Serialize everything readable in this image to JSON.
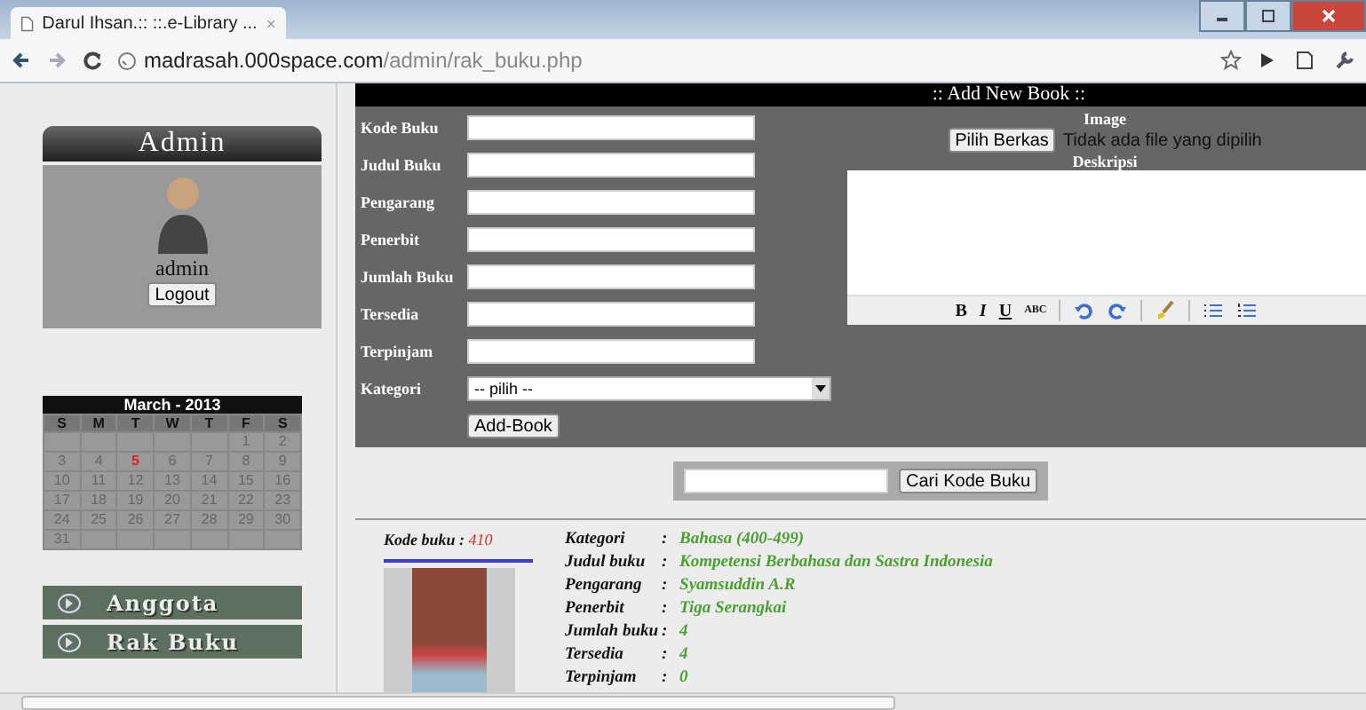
{
  "browser": {
    "tab_title": "Darul Ihsan.:: ::.e-Library ...",
    "url_host": "madrasah.000space.com",
    "url_path": "/admin/rak_buku.php"
  },
  "sidebar": {
    "admin_title": "Admin",
    "username": "admin",
    "logout_label": "Logout",
    "calendar": {
      "title": "March - 2013",
      "weekdays": [
        "S",
        "M",
        "T",
        "W",
        "T",
        "F",
        "S"
      ],
      "weeks": [
        [
          {
            "kind": "blank"
          },
          {
            "kind": "blank"
          },
          {
            "kind": "blank"
          },
          {
            "kind": "blank"
          },
          {
            "kind": "blank"
          },
          {
            "day": "1",
            "today": false
          },
          {
            "day": "2",
            "today": false
          }
        ],
        [
          {
            "day": "3",
            "today": false
          },
          {
            "day": "4",
            "today": false
          },
          {
            "day": "5",
            "today": true
          },
          {
            "day": "6",
            "today": false
          },
          {
            "day": "7",
            "today": false
          },
          {
            "day": "8",
            "today": false
          },
          {
            "day": "9",
            "today": false
          }
        ],
        [
          {
            "day": "10",
            "today": false
          },
          {
            "day": "11",
            "today": false
          },
          {
            "day": "12",
            "today": false
          },
          {
            "day": "13",
            "today": false
          },
          {
            "day": "14",
            "today": false
          },
          {
            "day": "15",
            "today": false
          },
          {
            "day": "16",
            "today": false
          }
        ],
        [
          {
            "day": "17",
            "today": false
          },
          {
            "day": "18",
            "today": false
          },
          {
            "day": "19",
            "today": false
          },
          {
            "day": "20",
            "today": false
          },
          {
            "day": "21",
            "today": false
          },
          {
            "day": "22",
            "today": false
          },
          {
            "day": "23",
            "today": false
          }
        ],
        [
          {
            "day": "24",
            "today": false
          },
          {
            "day": "25",
            "today": false
          },
          {
            "day": "26",
            "today": false
          },
          {
            "day": "27",
            "today": false
          },
          {
            "day": "28",
            "today": false
          },
          {
            "day": "29",
            "today": false
          },
          {
            "day": "30",
            "today": false
          }
        ],
        [
          {
            "day": "31",
            "today": false
          },
          {
            "kind": "blank"
          },
          {
            "kind": "blank"
          },
          {
            "kind": "blank"
          },
          {
            "kind": "blank"
          },
          {
            "kind": "blank"
          },
          {
            "kind": "blank"
          }
        ]
      ]
    },
    "menu": [
      "Anggota",
      "Rak Buku"
    ]
  },
  "form": {
    "title": ":: Add New Book ::",
    "fields": [
      "Kode Buku",
      "Judul Buku",
      "Pengarang",
      "Penerbit",
      "Jumlah Buku",
      "Tersedia",
      "Terpinjam"
    ],
    "category": {
      "label": "Kategori",
      "value": "-- pilih --"
    },
    "submit_label": "Add-Book",
    "image": {
      "label": "Image",
      "button": "Pilih Berkas",
      "status": "Tidak ada file yang dipilih"
    },
    "description_label": "Deskripsi",
    "editor_text_buttons": [
      "B",
      "I",
      "U",
      "ABC"
    ]
  },
  "search": {
    "button": "Cari Kode Buku"
  },
  "book": {
    "code_label": "Kode buku :",
    "code": "410",
    "details": [
      {
        "label": "Kategori",
        "value": "Bahasa (400-499)"
      },
      {
        "label": "Judul buku",
        "value": "Kompetensi Berbahasa dan Sastra Indonesia"
      },
      {
        "label": "Pengarang",
        "value": "Syamsuddin A.R"
      },
      {
        "label": "Penerbit",
        "value": "Tiga Serangkai"
      },
      {
        "label": "Jumlah buku",
        "value": "4"
      },
      {
        "label": "Tersedia",
        "value": "4"
      },
      {
        "label": "Terpinjam",
        "value": "0"
      }
    ],
    "separator": ":"
  }
}
